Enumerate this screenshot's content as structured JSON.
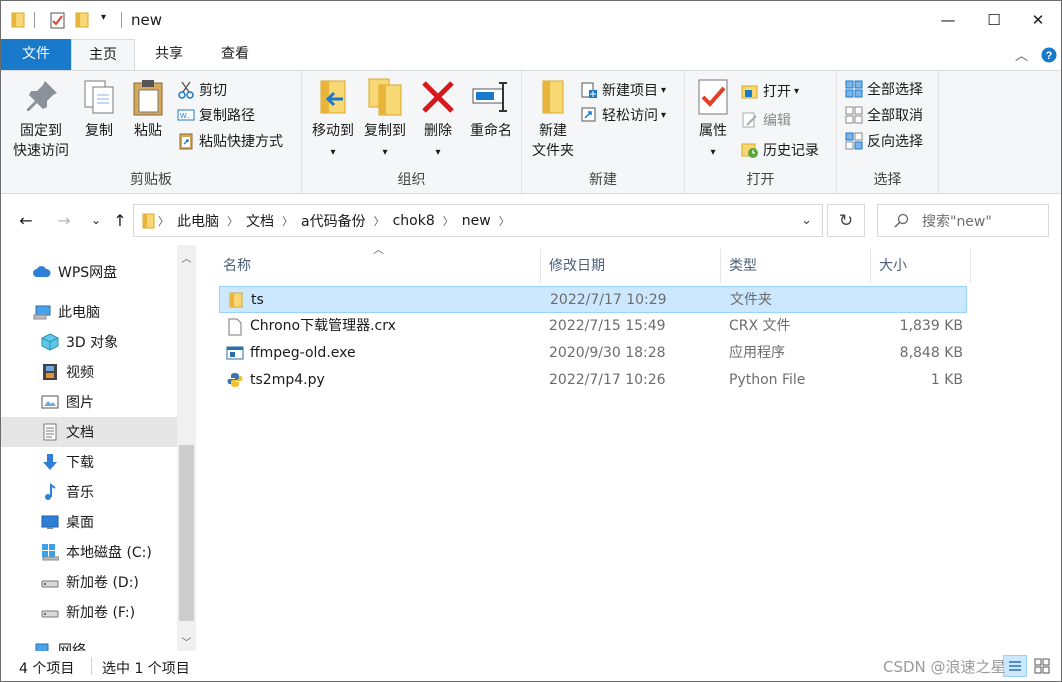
{
  "window": {
    "title": "new",
    "controls": {
      "minimize": "—",
      "maximize": "☐",
      "close": "✕"
    }
  },
  "tabs": [
    {
      "label": "文件"
    },
    {
      "label": "主页"
    },
    {
      "label": "共享"
    },
    {
      "label": "查看"
    }
  ],
  "ribbon": {
    "clipboard": {
      "label": "剪贴板",
      "pin_l1": "固定到",
      "pin_l2": "快速访问",
      "copy": "复制",
      "paste": "粘贴",
      "cut": "剪切",
      "copy_path": "复制路径",
      "paste_shortcut": "粘贴快捷方式"
    },
    "organize": {
      "label": "组织",
      "move_to": "移动到",
      "copy_to": "复制到",
      "delete": "删除",
      "rename": "重命名"
    },
    "new": {
      "label": "新建",
      "new_folder_l1": "新建",
      "new_folder_l2": "文件夹",
      "new_item": "新建项目",
      "easy_access": "轻松访问"
    },
    "open": {
      "label": "打开",
      "properties": "属性",
      "open": "打开",
      "edit": "编辑",
      "history": "历史记录"
    },
    "select": {
      "label": "选择",
      "select_all": "全部选择",
      "select_none": "全部取消",
      "invert": "反向选择"
    }
  },
  "address": {
    "crumbs": [
      "此电脑",
      "文档",
      "a代码备份",
      "chok8",
      "new"
    ],
    "search_placeholder": "搜索\"new\""
  },
  "nav": {
    "items": [
      {
        "label": "WPS网盘",
        "icon": "cloud-icon"
      },
      {
        "label": "此电脑",
        "icon": "computer-icon"
      },
      {
        "label": "3D 对象",
        "icon": "cube-icon"
      },
      {
        "label": "视频",
        "icon": "film-icon"
      },
      {
        "label": "图片",
        "icon": "picture-icon"
      },
      {
        "label": "文档",
        "icon": "document-icon"
      },
      {
        "label": "下载",
        "icon": "download-icon"
      },
      {
        "label": "音乐",
        "icon": "music-icon"
      },
      {
        "label": "桌面",
        "icon": "desktop-icon"
      },
      {
        "label": "本地磁盘 (C:)",
        "icon": "drive-c-icon"
      },
      {
        "label": "新加卷 (D:)",
        "icon": "drive-icon"
      },
      {
        "label": "新加卷 (F:)",
        "icon": "drive-icon"
      },
      {
        "label": "网络",
        "icon": "network-icon"
      }
    ]
  },
  "columns": {
    "name": "名称",
    "date": "修改日期",
    "type": "类型",
    "size": "大小"
  },
  "files": [
    {
      "name": "ts",
      "date": "2022/7/17 10:29",
      "type": "文件夹",
      "size": "",
      "icon": "folder-icon"
    },
    {
      "name": "Chrono下载管理器.crx",
      "date": "2022/7/15 15:49",
      "type": "CRX 文件",
      "size": "1,839 KB",
      "icon": "file-icon"
    },
    {
      "name": "ffmpeg-old.exe",
      "date": "2020/9/30 18:28",
      "type": "应用程序",
      "size": "8,848 KB",
      "icon": "exe-icon"
    },
    {
      "name": "ts2mp4.py",
      "date": "2022/7/17 10:26",
      "type": "Python File",
      "size": "1 KB",
      "icon": "python-icon"
    }
  ],
  "status": {
    "count": "4 个项目",
    "selected": "选中 1 个项目"
  },
  "watermark": "CSDN @浪速之星",
  "colors": {
    "accent": "#1979ca",
    "selection": "#cce8ff",
    "selection_border": "#99d1ff",
    "folder": "#f8d775"
  }
}
